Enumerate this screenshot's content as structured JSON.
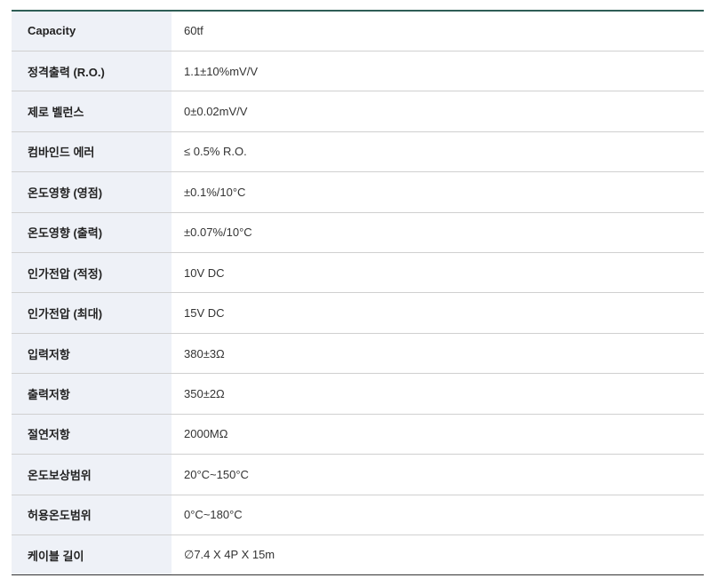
{
  "spec_table": {
    "rows": [
      {
        "label": "Capacity",
        "value": "60tf"
      },
      {
        "label": "정격출력 (R.O.)",
        "value": "1.1±10%mV/V"
      },
      {
        "label": "제로 벨런스",
        "value": "0±0.02mV/V"
      },
      {
        "label": "컴바인드 에러",
        "value": "≤ 0.5% R.O."
      },
      {
        "label": "온도영향 (영점)",
        "value": "±0.1%/10°C"
      },
      {
        "label": "온도영향 (출력)",
        "value": "±0.07%/10°C"
      },
      {
        "label": "인가전압 (적정)",
        "value": "10V DC"
      },
      {
        "label": "인가전압 (최대)",
        "value": "15V DC"
      },
      {
        "label": "입력저항",
        "value": "380±3Ω"
      },
      {
        "label": "출력저항",
        "value": "350±2Ω"
      },
      {
        "label": "절연저항",
        "value": "2000MΩ"
      },
      {
        "label": "온도보상범위",
        "value": "20°C~150°C"
      },
      {
        "label": "허용온도범위",
        "value": "0°C~180°C"
      },
      {
        "label": "케이블 길이",
        "value": "∅7.4 X 4P X 15m"
      }
    ]
  },
  "colors": {
    "header_border": "#2e5e56",
    "label_background": "#eef1f7",
    "row_divider": "#d0d0d0"
  }
}
